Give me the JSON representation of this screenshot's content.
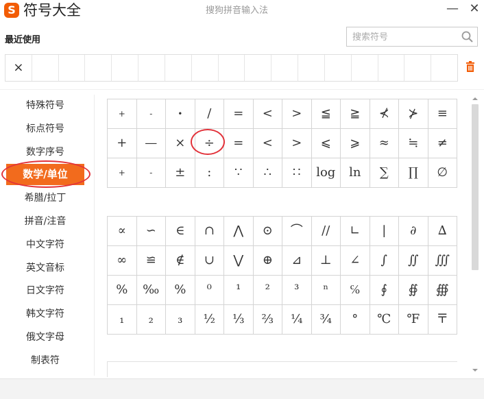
{
  "window": {
    "title": "符号大全",
    "logo_letter": "S",
    "ime_name": "搜狗拼音输入法",
    "minimize": "—",
    "close": "✕"
  },
  "recent": {
    "label": "最近使用",
    "items": [
      "×",
      "",
      "",
      "",
      "",
      "",
      "",
      "",
      "",
      "",
      "",
      "",
      "",
      "",
      "",
      "",
      ""
    ]
  },
  "search": {
    "placeholder": "搜索符号"
  },
  "sidebar": {
    "items": [
      {
        "label": "特殊符号"
      },
      {
        "label": "标点符号"
      },
      {
        "label": "数字序号"
      },
      {
        "label": "数学/单位",
        "active": true
      },
      {
        "label": "希腊/拉丁"
      },
      {
        "label": "拼音/注音"
      },
      {
        "label": "中文字符"
      },
      {
        "label": "英文音标"
      },
      {
        "label": "日文字符"
      },
      {
        "label": "韩文字符"
      },
      {
        "label": "俄文字母"
      },
      {
        "label": "制表符"
      }
    ]
  },
  "grid1": [
    "+",
    "-",
    "•",
    "/",
    "=",
    "<",
    ">",
    "≦",
    "≧",
    "⊀",
    "⊁",
    "≡",
    "+",
    "—",
    "×",
    "÷",
    "=",
    "<",
    ">",
    "⩽",
    "⩾",
    "≈",
    "≒",
    "≠",
    "+",
    "-",
    "±",
    ":",
    "∵",
    "∴",
    "∷",
    "log",
    "ln",
    "∑",
    "∏",
    "∅"
  ],
  "grid2": [
    "∝",
    "∽",
    "∈",
    "∩",
    "⋀",
    "⊙",
    "⌒",
    "//",
    "∟",
    "|",
    "∂",
    "∆",
    "∞",
    "≌",
    "∉",
    "∪",
    "⋁",
    "⊕",
    "⊿",
    "⊥",
    "∠",
    "∫",
    "∬",
    "∭",
    "%",
    "‰",
    "%",
    "⁰",
    "¹",
    "²",
    "³",
    "ⁿ",
    "℅",
    "∮",
    "∯",
    "∰",
    "₁",
    "₂",
    "₃",
    "½",
    "⅓",
    "⅔",
    "¼",
    "¾",
    "°",
    "℃",
    "℉",
    "〒"
  ],
  "colors": {
    "accent": "#f26b1d",
    "annotation": "#e2323a",
    "border": "#d4d4d4"
  }
}
